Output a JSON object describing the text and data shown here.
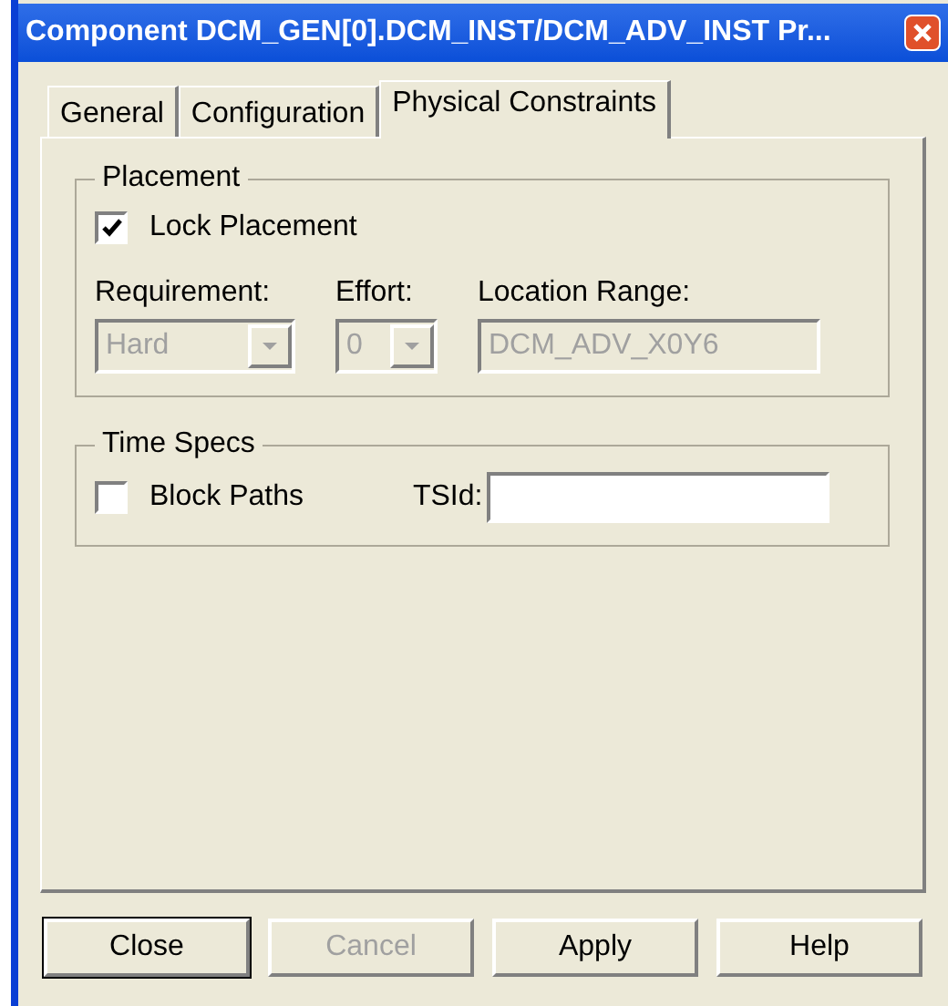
{
  "window": {
    "title": "Component DCM_GEN[0].DCM_INST/DCM_ADV_INST Pr..."
  },
  "tabs": [
    {
      "label": "General",
      "selected": false
    },
    {
      "label": "Configuration",
      "selected": false
    },
    {
      "label": "Physical Constraints",
      "selected": true
    }
  ],
  "placement": {
    "title": "Placement",
    "lock": {
      "label": "Lock Placement",
      "checked": true
    },
    "requirement": {
      "label": "Requirement:",
      "value": "Hard",
      "disabled": true
    },
    "effort": {
      "label": "Effort:",
      "value": "0",
      "disabled": true
    },
    "location_range": {
      "label": "Location Range:",
      "value": "DCM_ADV_X0Y6",
      "disabled": true
    }
  },
  "time_specs": {
    "title": "Time Specs",
    "block_paths": {
      "label": "Block Paths",
      "checked": false
    },
    "tsid": {
      "label": "TSId:"
    }
  },
  "buttons": [
    {
      "label": "Close",
      "disabled": false,
      "default": true
    },
    {
      "label": "Cancel",
      "disabled": true,
      "default": false
    },
    {
      "label": "Apply",
      "disabled": false,
      "default": false
    },
    {
      "label": "Help",
      "disabled": false,
      "default": false
    }
  ]
}
